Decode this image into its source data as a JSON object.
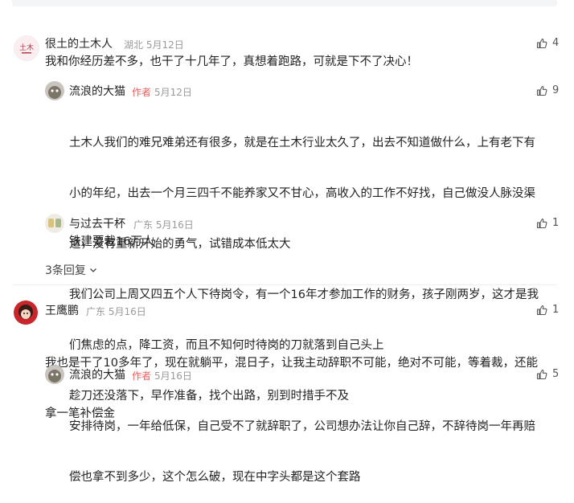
{
  "comments": [
    {
      "user": "很土的土木人",
      "location": "湖北",
      "date": "5月12日",
      "likes": "4",
      "text": "我和你经历差不多，也干了十几年了，真想着跑路，可就是下不了决心！",
      "replies": [
        {
          "user": "流浪的大猫",
          "tag": "作者",
          "date": "5月12日",
          "likes": "9",
          "lines": [
            "土木人我们的难兄难弟还有很多，就是在土木行业太久了，出去不知道做什么，上有老下有",
            "小的年纪，出去一个月三四千不能养家又不甘心，高收入的工作不好找，自己做没人脉没渠",
            "道，没有重新开始的勇气，试错成本低太大",
            "我们公司上周又四五个人下待岗令，有一个16年才参加工作的财务，孩子刚两岁，这才是我",
            "们焦虑的点，降工资，而且不知何时待岗的刀就落到自己头上",
            "趁刀还没落下，早作准备，找个出路，别到时措手不及"
          ]
        },
        {
          "user": "与过去干杯",
          "location": "广东",
          "date": "5月16日",
          "likes": "1",
          "text": "铁建要裁16万人"
        }
      ],
      "more_replies": "3条回复"
    },
    {
      "user": "王鹰鹏",
      "location": "广东",
      "date": "5月16日",
      "likes": "1",
      "lines": [
        "我也是干了10多年了，现在就躺平，混日子，让我主动辞职不可能，绝对不可能，等着裁，还能",
        "拿一笔补偿金"
      ],
      "replies": [
        {
          "user": "流浪的大猫",
          "tag": "作者",
          "date": "5月16日",
          "likes": "5",
          "lines": [
            "安排待岗，一年给低保，自己受不了就辞职了，公司想办法让你自己辞，不辞待岗一年再赔",
            "偿也拿不到多少，这个怎么破，现在中字头都是这个套路"
          ]
        }
      ]
    }
  ],
  "icons": {
    "like": "thumbs-up-icon",
    "expand": "chevron-down-icon"
  },
  "colors": {
    "author_tag": "#f85959",
    "meta": "#999999"
  }
}
